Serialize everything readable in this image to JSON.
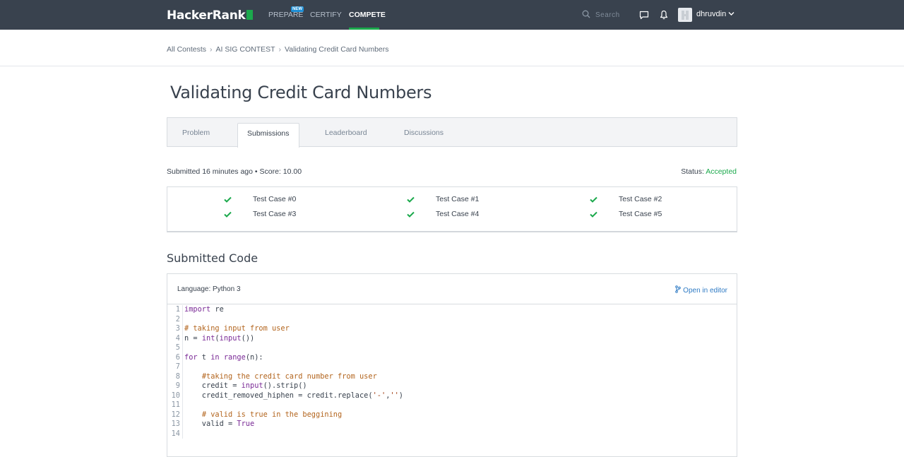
{
  "brand": {
    "logo_text": "HackerRank",
    "accent": "#1ba94c"
  },
  "nav": {
    "items": [
      {
        "label": "PREPARE",
        "badge": "NEW"
      },
      {
        "label": "CERTIFY"
      },
      {
        "label": "COMPETE",
        "active": true
      }
    ],
    "search_placeholder": "Search",
    "username": "dhruvdin"
  },
  "breadcrumb": {
    "items": [
      "All Contests",
      "AI SIG CONTEST",
      "Validating Credit Card Numbers"
    ]
  },
  "page_title": "Validating Credit Card Numbers",
  "tabs": [
    {
      "label": "Problem"
    },
    {
      "label": "Submissions",
      "active": true
    },
    {
      "label": "Leaderboard"
    },
    {
      "label": "Discussions"
    }
  ],
  "submission": {
    "meta": "Submitted 16 minutes ago • Score: 10.00",
    "status_label": "Status:",
    "status_value": "Accepted"
  },
  "test_cases": [
    "Test Case #0",
    "Test Case #1",
    "Test Case #2",
    "Test Case #3",
    "Test Case #4",
    "Test Case #5"
  ],
  "code_section": {
    "title": "Submitted Code",
    "language": "Language: Python 3",
    "open_in_editor": "Open in editor"
  },
  "code_lines": [
    "import re",
    "",
    "# taking input from user",
    "n = int(input())",
    "",
    "for t in range(n):",
    "",
    "    #taking the credit card number from user",
    "    credit = input().strip()",
    "    credit_removed_hiphen = credit.replace('-','')",
    "",
    "    # valid is true in the beggining",
    "    valid = True",
    ""
  ]
}
